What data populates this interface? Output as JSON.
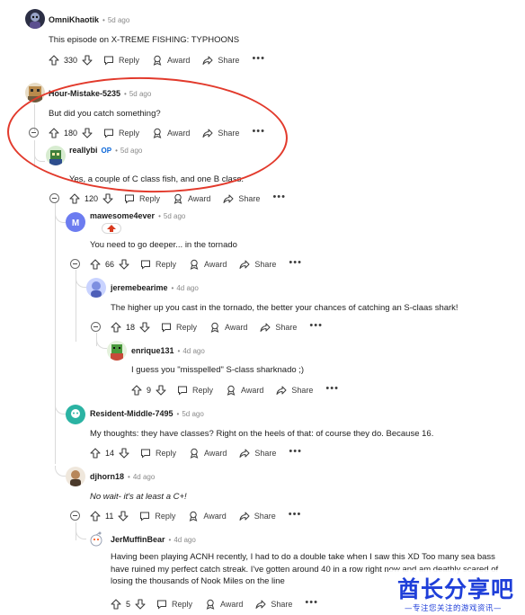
{
  "colors": {
    "oval": "#e23a2c",
    "op_tag": "#0a66d8",
    "watermark": "#1f3fd9",
    "thread_line": "#dadada"
  },
  "icons": [
    "upvote-icon",
    "downvote-icon",
    "reply-bubble-icon",
    "award-icon",
    "share-arrow-icon",
    "more-icon",
    "collapse-icon",
    "avatar-icon"
  ],
  "labels": {
    "reply": "Reply",
    "award": "Award",
    "share": "Share",
    "more": "•••"
  },
  "comments": [
    {
      "author": "OmniKhaotik",
      "time": "5d ago",
      "text": "This episode on X-TREME FISHING: TYPHOONS",
      "votes": "330"
    },
    {
      "author": "Hour-Mistake-5235",
      "time": "5d ago",
      "text": "But did you catch something?",
      "votes": "180"
    },
    {
      "author": "reallybi",
      "op": "OP",
      "time": "5d ago",
      "text": "Yes, a couple of C class fish, and one B class.",
      "votes": "120"
    },
    {
      "author": "mawesome4ever",
      "time": "5d ago",
      "text": "You need to go deeper... in the tornado",
      "votes": "66"
    },
    {
      "author": "jeremebearime",
      "time": "4d ago",
      "text": "The higher up you cast in the tornado, the better your chances of catching an S-claas shark!",
      "votes": "18"
    },
    {
      "author": "enrique131",
      "time": "4d ago",
      "text": "I guess you \"misspelled\" S-class sharknado ;)",
      "votes": "9"
    },
    {
      "author": "Resident-Middle-7495",
      "time": "5d ago",
      "text": "My thoughts: they have classes? Right on the heels of that: of course they do.  Because 16.",
      "votes": "14"
    },
    {
      "author": "djhorn18",
      "time": "4d ago",
      "text": "No wait- it's at least a C+!",
      "votes": "11"
    },
    {
      "author": "JerMuffinBear",
      "time": "4d ago",
      "text": "Having been playing ACNH recently, I had to do a double take when I saw this XD Too many sea bass have ruined my perfect catch streak. I've gotten around 40 in a row right now and am deathly scared of losing the thousands of Nook Miles on the line",
      "votes": "5"
    }
  ],
  "watermark": {
    "title": "酋长分享吧",
    "subtitle": "—专注您关注的游戏资讯—"
  }
}
